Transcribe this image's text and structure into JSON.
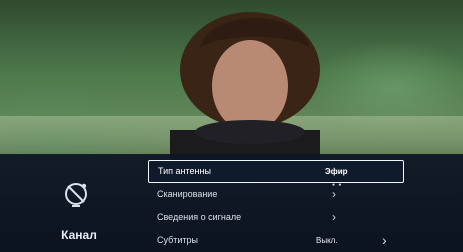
{
  "category": {
    "label": "Канал",
    "icon": "satellite-dish-icon"
  },
  "menu": {
    "items": [
      {
        "label": "Тип антенны",
        "value": "Эфир",
        "selected": true
      },
      {
        "label": "Сканирование",
        "value": "",
        "chevron": "›"
      },
      {
        "label": "Сведения о сигнале",
        "value": "",
        "chevron": "›"
      },
      {
        "label": "Субтитры",
        "value": "Выкл.",
        "chevron": "›"
      }
    ]
  },
  "colors": {
    "panel": "#0c1424",
    "selection_border": "#f2f5f8",
    "text": "#d8e0ea"
  }
}
